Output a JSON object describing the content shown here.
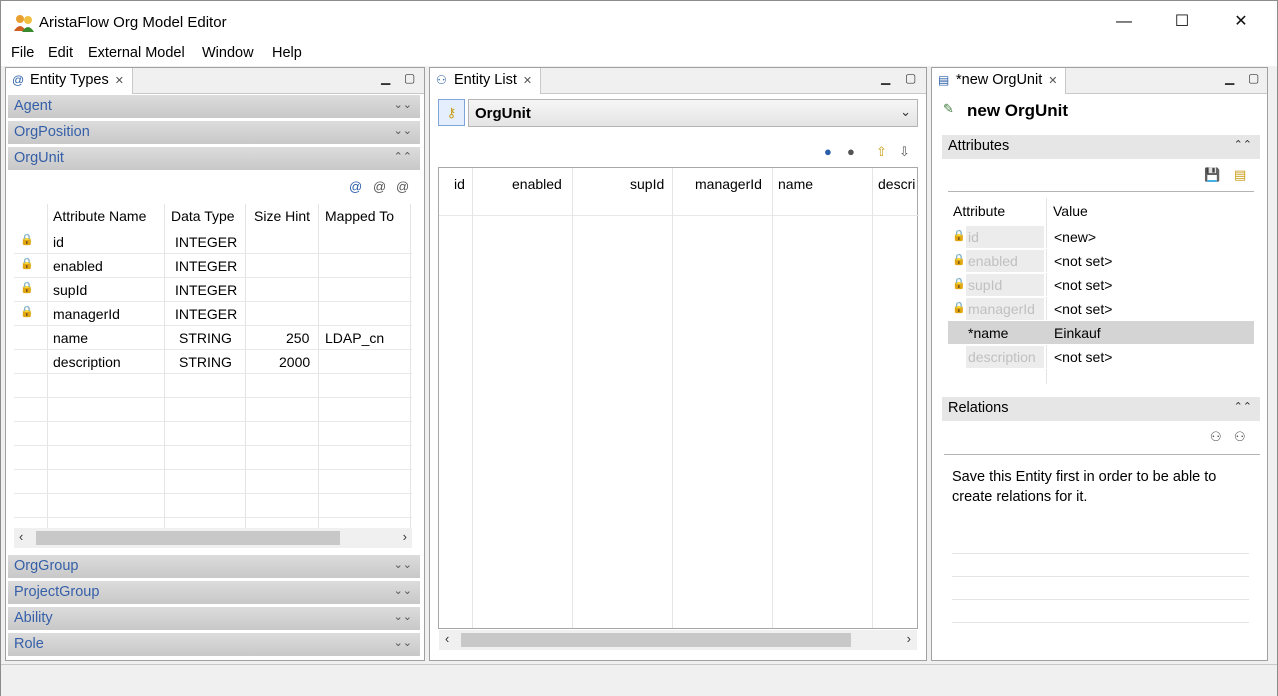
{
  "window": {
    "title": "AristaFlow Org Model Editor",
    "minimize": "—",
    "maximize": "☐",
    "close": "✕"
  },
  "menu": [
    "File",
    "Edit",
    "External Model",
    "Window",
    "Help"
  ],
  "entity_types_view": {
    "tab": "Entity Types",
    "groups_top": [
      "Agent",
      "OrgPosition",
      "OrgUnit"
    ],
    "groups_bottom": [
      "OrgGroup",
      "ProjectGroup",
      "Ability",
      "Role"
    ],
    "columns": [
      "Attribute Name",
      "Data Type",
      "Size Hint",
      "Mapped To"
    ],
    "rows": [
      {
        "icon": "key",
        "name": "id",
        "type": "INTEGER",
        "size": "",
        "mapped": ""
      },
      {
        "icon": "lock",
        "name": "enabled",
        "type": "INTEGER",
        "size": "",
        "mapped": ""
      },
      {
        "icon": "key",
        "name": "supId",
        "type": "INTEGER",
        "size": "",
        "mapped": ""
      },
      {
        "icon": "key",
        "name": "managerId",
        "type": "INTEGER",
        "size": "",
        "mapped": ""
      },
      {
        "icon": "",
        "name": "name",
        "type": "STRING",
        "size": "250",
        "mapped": "LDAP_cn"
      },
      {
        "icon": "",
        "name": "description",
        "type": "STRING",
        "size": "2000",
        "mapped": ""
      }
    ]
  },
  "entity_list_view": {
    "tab": "Entity List",
    "selected_type": "OrgUnit",
    "columns": [
      "id",
      "enabled",
      "supId",
      "managerId",
      "name",
      "descri"
    ]
  },
  "editor_view": {
    "tab": "*new OrgUnit",
    "title": "new OrgUnit",
    "attributes_header": "Attributes",
    "attr_columns": [
      "Attribute",
      "Value"
    ],
    "attributes": [
      {
        "key": "id",
        "value": "<new>",
        "icon": "key"
      },
      {
        "key": "enabled",
        "value": "<not set>",
        "icon": "lock"
      },
      {
        "key": "supId",
        "value": "<not set>",
        "icon": "key"
      },
      {
        "key": "managerId",
        "value": "<not set>",
        "icon": "key"
      },
      {
        "key": "*name",
        "value": "Einkauf",
        "icon": ""
      },
      {
        "key": "description",
        "value": "<not set>",
        "icon": ""
      }
    ],
    "relations_header": "Relations",
    "relations_message": "Save this Entity first in order to be able to create relations for it."
  }
}
